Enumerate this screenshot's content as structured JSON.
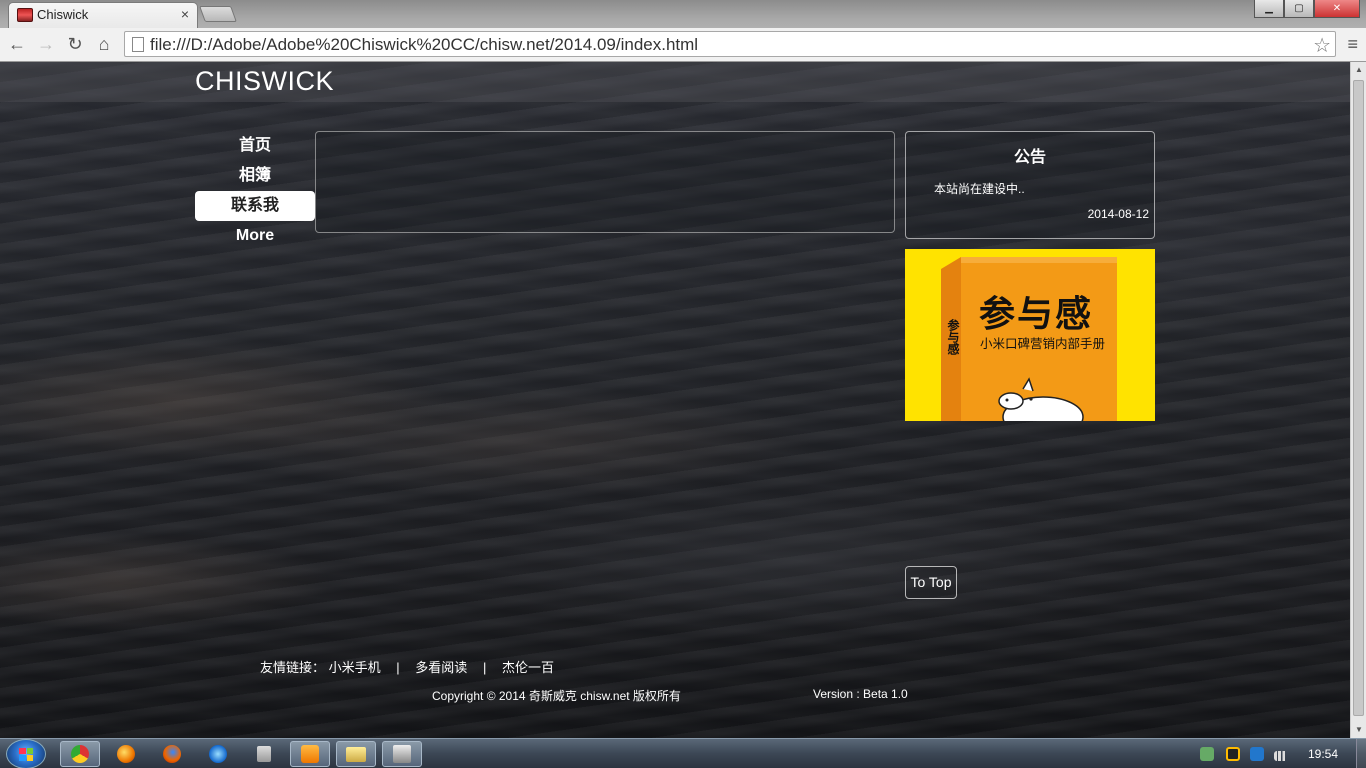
{
  "browser": {
    "tab_title": "Chiswick",
    "tab_close": "×",
    "url": "file:///D:/Adobe/Adobe%20Chiswick%20CC/chisw.net/2014.09/index.html",
    "window_buttons": {
      "minimize": "▁",
      "maximize": "▢",
      "close": "✕"
    },
    "nav": {
      "back": "←",
      "forward": "→",
      "reload": "↻",
      "home": "⌂",
      "star": "☆",
      "menu": "≡"
    }
  },
  "site": {
    "title": "CHISWICK",
    "nav_items": [
      "首页",
      "相簿",
      "联系我",
      "More"
    ],
    "active_nav": "联系我",
    "notice": {
      "title": "公告",
      "text": "本站尚在建设中..",
      "date": "2014-08-12"
    },
    "ad": {
      "title": "参与感",
      "subtitle": "小米口碑营销内部手册",
      "spine": "参与感",
      "colors": {
        "background": "#ffe300",
        "book": "#f39a16"
      }
    },
    "to_top": "To Top",
    "footer": {
      "links_label": "友情链接：",
      "links": [
        "小米手机",
        "多看阅读",
        "杰伦一百"
      ],
      "separator": "|",
      "copyright": "Copyright © 2014 奇斯威克 chisw.net 版权所有",
      "version": "Version : Beta 1.0"
    }
  },
  "taskbar": {
    "apps": [
      "chrome-icon",
      "firefox-alt-icon",
      "firefox-icon",
      "ie-icon",
      "notepad-icon",
      "media-player-icon",
      "explorer-icon",
      "app-icon"
    ],
    "clock": "19:54"
  }
}
